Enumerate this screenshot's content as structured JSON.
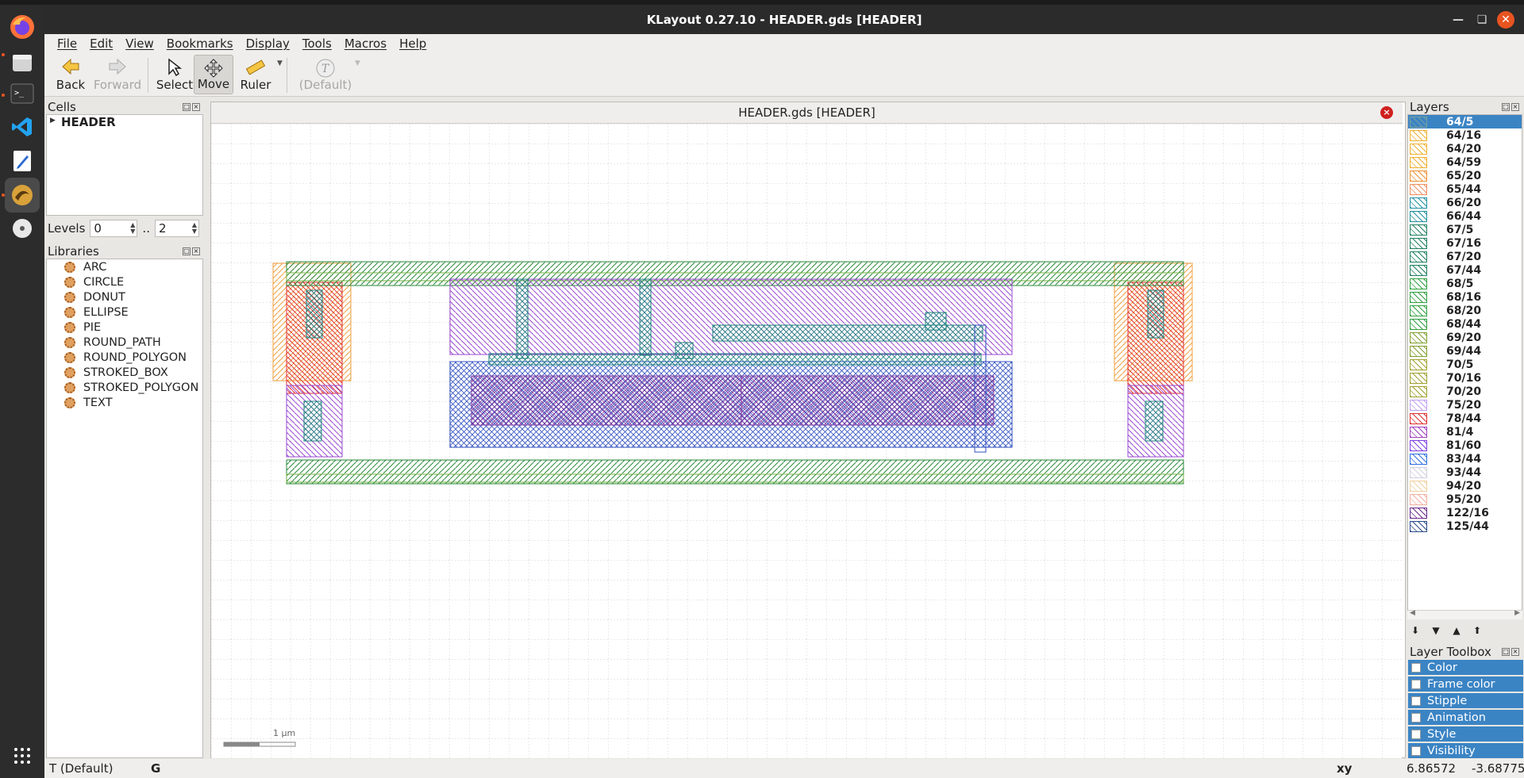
{
  "window": {
    "title": "KLayout 0.27.10 - HEADER.gds [HEADER]"
  },
  "dock": {
    "icons": [
      "firefox-icon",
      "files-icon",
      "terminal-icon",
      "vscode-icon",
      "text-editor-icon",
      "klayout-icon",
      "disc-icon",
      "app-grid-icon"
    ]
  },
  "menu": [
    "File",
    "Edit",
    "View",
    "Bookmarks",
    "Display",
    "Tools",
    "Macros",
    "Help"
  ],
  "toolbar": {
    "back": "Back",
    "forward": "Forward",
    "select": "Select",
    "move": "Move",
    "ruler": "Ruler",
    "default": "(Default)"
  },
  "cells": {
    "title": "Cells",
    "items": [
      "HEADER"
    ]
  },
  "levels": {
    "label": "Levels",
    "from": "0",
    "sep": "..",
    "to": "2"
  },
  "libraries": {
    "title": "Libraries",
    "items": [
      "ARC",
      "CIRCLE",
      "DONUT",
      "ELLIPSE",
      "PIE",
      "ROUND_PATH",
      "ROUND_POLYGON",
      "STROKED_BOX",
      "STROKED_POLYGON",
      "TEXT"
    ]
  },
  "canvas": {
    "tab_title": "HEADER.gds [HEADER]",
    "scale_label": "1 µm"
  },
  "layers": {
    "title": "Layers",
    "items": [
      {
        "name": "64/5",
        "color": "#7aa0a0",
        "selected": true
      },
      {
        "name": "64/16",
        "color": "#f0b030"
      },
      {
        "name": "64/20",
        "color": "#f0b030"
      },
      {
        "name": "64/59",
        "color": "#f0b030"
      },
      {
        "name": "65/20",
        "color": "#f09030"
      },
      {
        "name": "65/44",
        "color": "#f09060"
      },
      {
        "name": "66/20",
        "color": "#2090a0"
      },
      {
        "name": "66/44",
        "color": "#2090a0"
      },
      {
        "name": "67/5",
        "color": "#208060"
      },
      {
        "name": "67/16",
        "color": "#208060"
      },
      {
        "name": "67/20",
        "color": "#208060"
      },
      {
        "name": "67/44",
        "color": "#208060"
      },
      {
        "name": "68/5",
        "color": "#30a040"
      },
      {
        "name": "68/16",
        "color": "#30a040"
      },
      {
        "name": "68/20",
        "color": "#30a040"
      },
      {
        "name": "68/44",
        "color": "#30a040"
      },
      {
        "name": "69/20",
        "color": "#80a030"
      },
      {
        "name": "69/44",
        "color": "#80a030"
      },
      {
        "name": "70/5",
        "color": "#a0a030"
      },
      {
        "name": "70/16",
        "color": "#a0a030"
      },
      {
        "name": "70/20",
        "color": "#a0a030"
      },
      {
        "name": "75/20",
        "color": "#c0a0f0"
      },
      {
        "name": "78/44",
        "color": "#e03030"
      },
      {
        "name": "81/4",
        "color": "#a040c0"
      },
      {
        "name": "81/60",
        "color": "#8040e0"
      },
      {
        "name": "83/44",
        "color": "#3070e0"
      },
      {
        "name": "93/44",
        "color": "#d0d0e0"
      },
      {
        "name": "94/20",
        "color": "#f0d0a0"
      },
      {
        "name": "95/20",
        "color": "#f0b0a0"
      },
      {
        "name": "122/16",
        "color": "#6a2a8a"
      },
      {
        "name": "125/44",
        "color": "#2a4a8a"
      }
    ]
  },
  "layer_toolbox": {
    "title": "Layer Toolbox",
    "items": [
      "Color",
      "Frame color",
      "Stipple",
      "Animation",
      "Style",
      "Visibility"
    ]
  },
  "status": {
    "mode": "T  (Default)",
    "grid": "G",
    "coord_label": "xy",
    "x": "6.86572",
    "y": "-3.68775"
  }
}
